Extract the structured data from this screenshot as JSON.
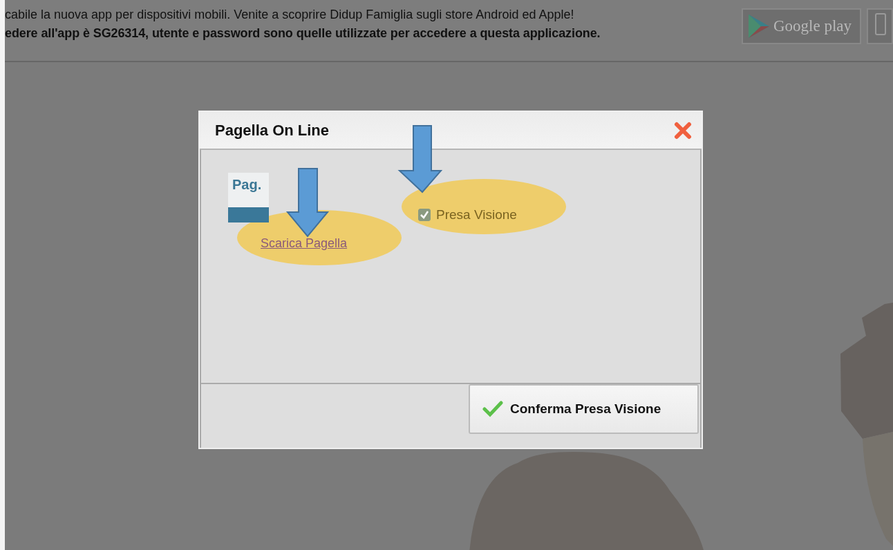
{
  "banner": {
    "lines": [
      {
        "text": "cabile la nuova app per dispositivi mobili. Venite a scoprire Didup Famiglia sugli store Android ed Apple!",
        "bold": false
      },
      {
        "text": "edere all'app è SG26314, utente e password sono quelle utilizzate per accedere a questa applicazione.",
        "bold": true
      }
    ],
    "store_badge": {
      "label": "Google play"
    }
  },
  "dialog": {
    "title": "Pagella On Line",
    "document_icon_label": "Pag.",
    "download_link": "Scarica Pagella",
    "acknowledgement": {
      "label": "Presa Visione",
      "checked": true
    },
    "confirm_button": "Conferma Presa Visione"
  }
}
